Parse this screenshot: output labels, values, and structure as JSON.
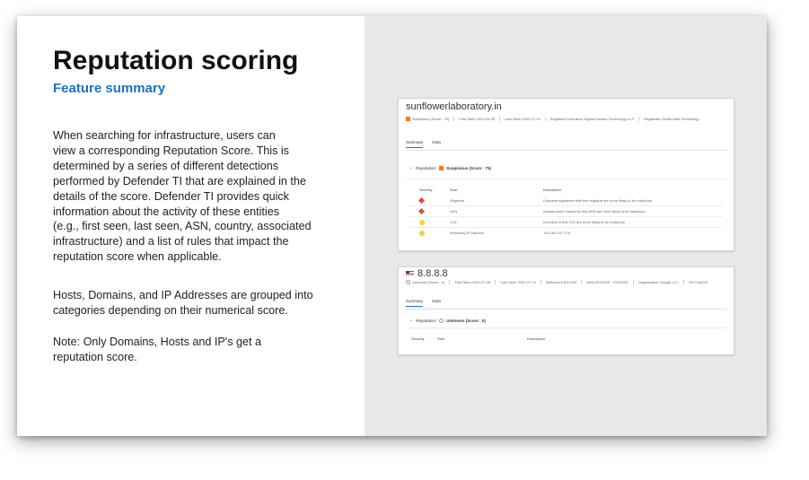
{
  "slide": {
    "title": "Reputation scoring",
    "subtitle": "Feature summary",
    "paragraphs": [
      "When searching for infrastructure, users can\nview a corresponding Reputation Score. This is\ndetermined by a series of different detections\nperformed by Defender TI that are explained in the\ndetails of the score.  Defender TI provides quick\ninformation about the activity of these entities\n(e.g., first seen, last seen, ASN, country, associated\ninfrastructure) and a list of rules that impact the\nreputation score when applicable.",
      "Hosts, Domains, and IP Addresses are grouped into\ncategories depending on their numerical score.",
      "Note: Only Domains, Hosts and IP's get a\nreputation score."
    ]
  },
  "colors": {
    "accent": "#1a73c9",
    "suspicious": "#f07c1d",
    "malicious": "#e04848",
    "warning": "#f1d23a"
  },
  "card1": {
    "title": "sunflowerlaboratory.in",
    "status": "Suspicious (Score : 75)",
    "first_seen_label": "First Seen",
    "first_seen": "2020-04-09",
    "last_seen_label": "Last Seen",
    "last_seen": "2022-07-13",
    "registrar_label": "Registrar",
    "registrar": "Endurance Digital Domain Technology LLP",
    "registrant_label": "Registrant",
    "registrant": "Globle Web Technology",
    "tabs": [
      "Summary",
      "Data"
    ],
    "reputation_label": "Reputation:",
    "reputation_value": "Suspicious (Score : 75)",
    "columns": [
      "Severity",
      "Rule",
      "Description"
    ],
    "rows": [
      {
        "severity": "high-severity-icon",
        "rule": "Registrar",
        "description": "Domains registered with this registrar are more likely to be malicious"
      },
      {
        "severity": "high-severity-icon",
        "rule": "ASN",
        "description": "Infrastructure hosted by this ASN are more likely to be malicious"
      },
      {
        "severity": "medium-severity-icon",
        "rule": "TLD",
        "description": "Domains in this TLD are more likely to be malicious"
      },
      {
        "severity": "medium-severity-icon",
        "rule": "Resolving IP Address",
        "description": "103.160.107.176"
      }
    ]
  },
  "card2": {
    "title": "8.8.8.8",
    "status": "Unknown (Score : 0)",
    "first_seen_label": "First Seen",
    "first_seen": "2010-07-26",
    "last_seen_label": "Last Seen",
    "last_seen": "2022-07-13",
    "netblock_label": "Netblock",
    "netblock": "8.8.8.0/24",
    "asn_label": "ASN",
    "asn": "AS15169 - GOOGLE",
    "org_label": "Organization",
    "org": "Google LLC",
    "os_label": "OS",
    "os": "CentOS",
    "tabs": [
      "Summary",
      "Data"
    ],
    "reputation_label": "Reputation:",
    "reputation_value": "Unknown (Score : 0)",
    "columns": [
      "Severity",
      "Rule",
      "Description"
    ]
  }
}
